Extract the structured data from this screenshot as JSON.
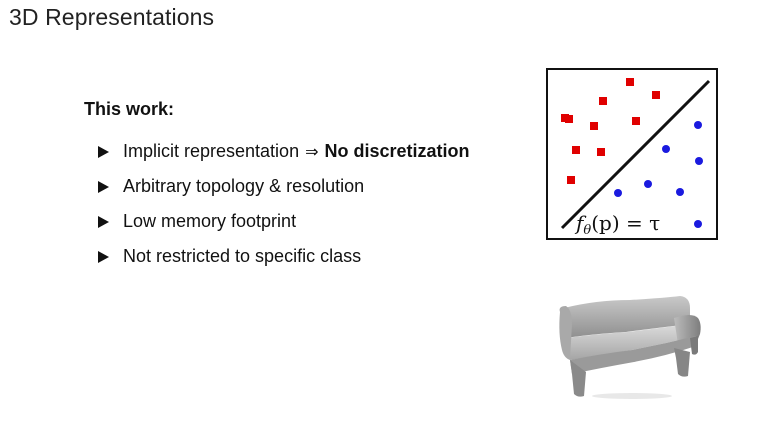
{
  "slide": {
    "title": "3D Representations",
    "heading": "This work:",
    "bullets": [
      {
        "text": "Implicit representation",
        "arrow": "⇒",
        "bold": "No discretization"
      },
      {
        "text": "Arbitrary topology & resolution"
      },
      {
        "text": "Low memory footprint"
      },
      {
        "text": "Not restricted to specific class"
      }
    ]
  },
  "diagram": {
    "formula": "fθ(p) = τ",
    "formula_parts": {
      "f": "f",
      "theta": "θ",
      "rest": "(p) = τ"
    },
    "colors": {
      "square": "#e00000",
      "dot": "#1a1adf",
      "line": "#111111"
    }
  },
  "icons": {
    "bullet": "triangle-right-icon",
    "sofa": "sofa-3d-render-icon"
  }
}
